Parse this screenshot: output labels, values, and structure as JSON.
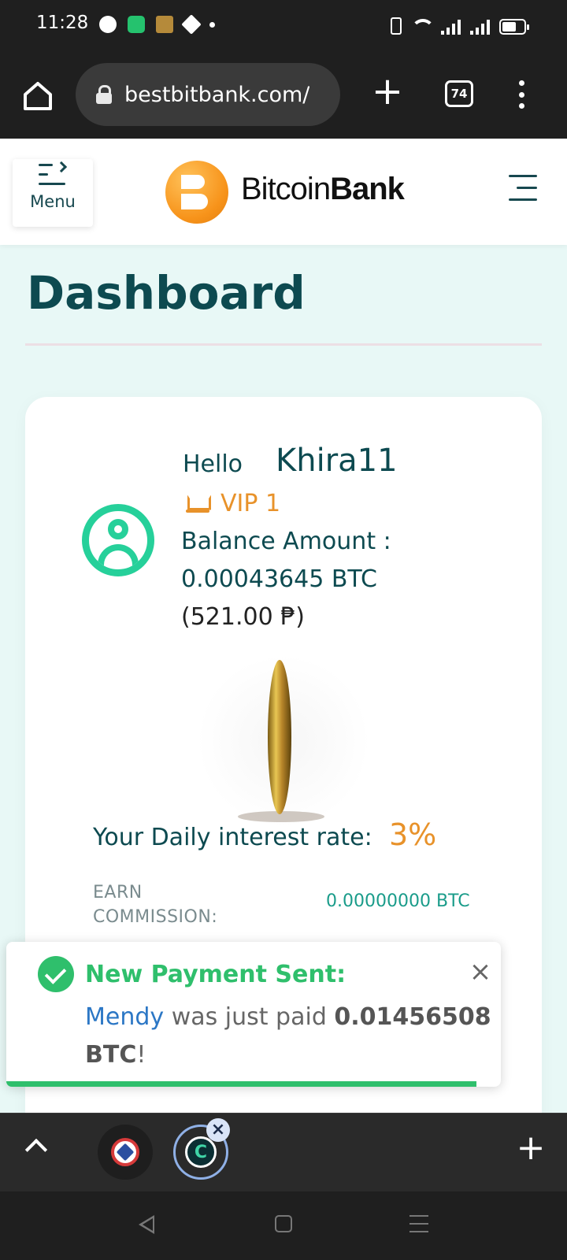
{
  "status_bar": {
    "time": "11:28",
    "notification_icons": [
      "messenger-icon",
      "battery-app-icon",
      "game-app-icon",
      "binance-icon",
      "dot-icon"
    ],
    "system_icons": [
      "vibrate-icon",
      "wifi-icon",
      "signal-icon",
      "signal-icon",
      "battery-icon"
    ]
  },
  "browser": {
    "url": "bestbitbank.com/",
    "tab_count": "74"
  },
  "site": {
    "menu_label": "Menu",
    "brand_regular": "Bitcoin",
    "brand_bold": "Bank",
    "brand_color": "#f7931a"
  },
  "dashboard": {
    "title": "Dashboard",
    "greeting": "Hello",
    "username": "Khira11",
    "vip_level": "VIP 1",
    "balance_label": "Balance Amount :",
    "balance_btc": "0.00043645 BTC",
    "balance_php": "(521.00 ₱)",
    "interest_label": "Your Daily interest rate:",
    "interest_value": "3%",
    "earn_label": "EARN COMMISSION:",
    "earn_value": "0.00000000 BTC"
  },
  "toast": {
    "title": "New Payment Sent:",
    "name": "Mendy",
    "middle": " was just paid ",
    "amount": "0.01456508 BTC",
    "suffix": "!",
    "progress": 0.95
  },
  "colors": {
    "primary_dark": "#0d4a50",
    "accent_orange": "#e8922a",
    "success_green": "#2fbf6c",
    "avatar_green": "#26d09a"
  }
}
